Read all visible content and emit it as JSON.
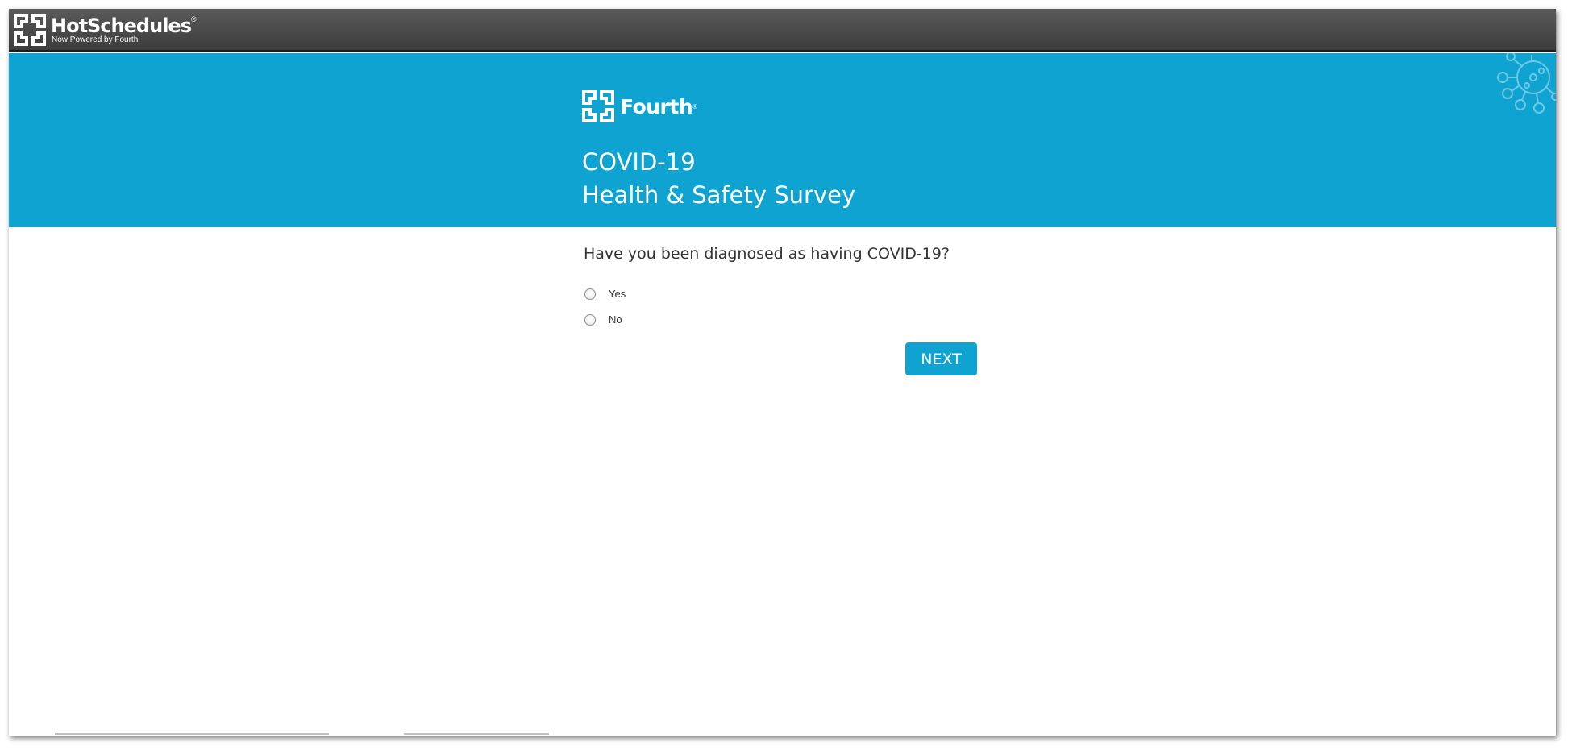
{
  "app": {
    "brand": "HotSchedules",
    "trademark": "®",
    "subtitle": "Now Powered by Fourth"
  },
  "hero": {
    "logo_text": "Fourth",
    "logo_trademark": "®",
    "title_line1": "COVID-19",
    "title_line2": "Health & Safety Survey",
    "icons": [
      "virus-icon"
    ]
  },
  "survey": {
    "question": "Have you been diagnosed as having COVID-19?",
    "options": [
      {
        "label": "Yes",
        "selected": false
      },
      {
        "label": "No",
        "selected": false
      }
    ],
    "next_label": "NEXT"
  },
  "colors": {
    "topbar": "#444444",
    "accent": "#0ea3d1",
    "text": "#333333"
  }
}
